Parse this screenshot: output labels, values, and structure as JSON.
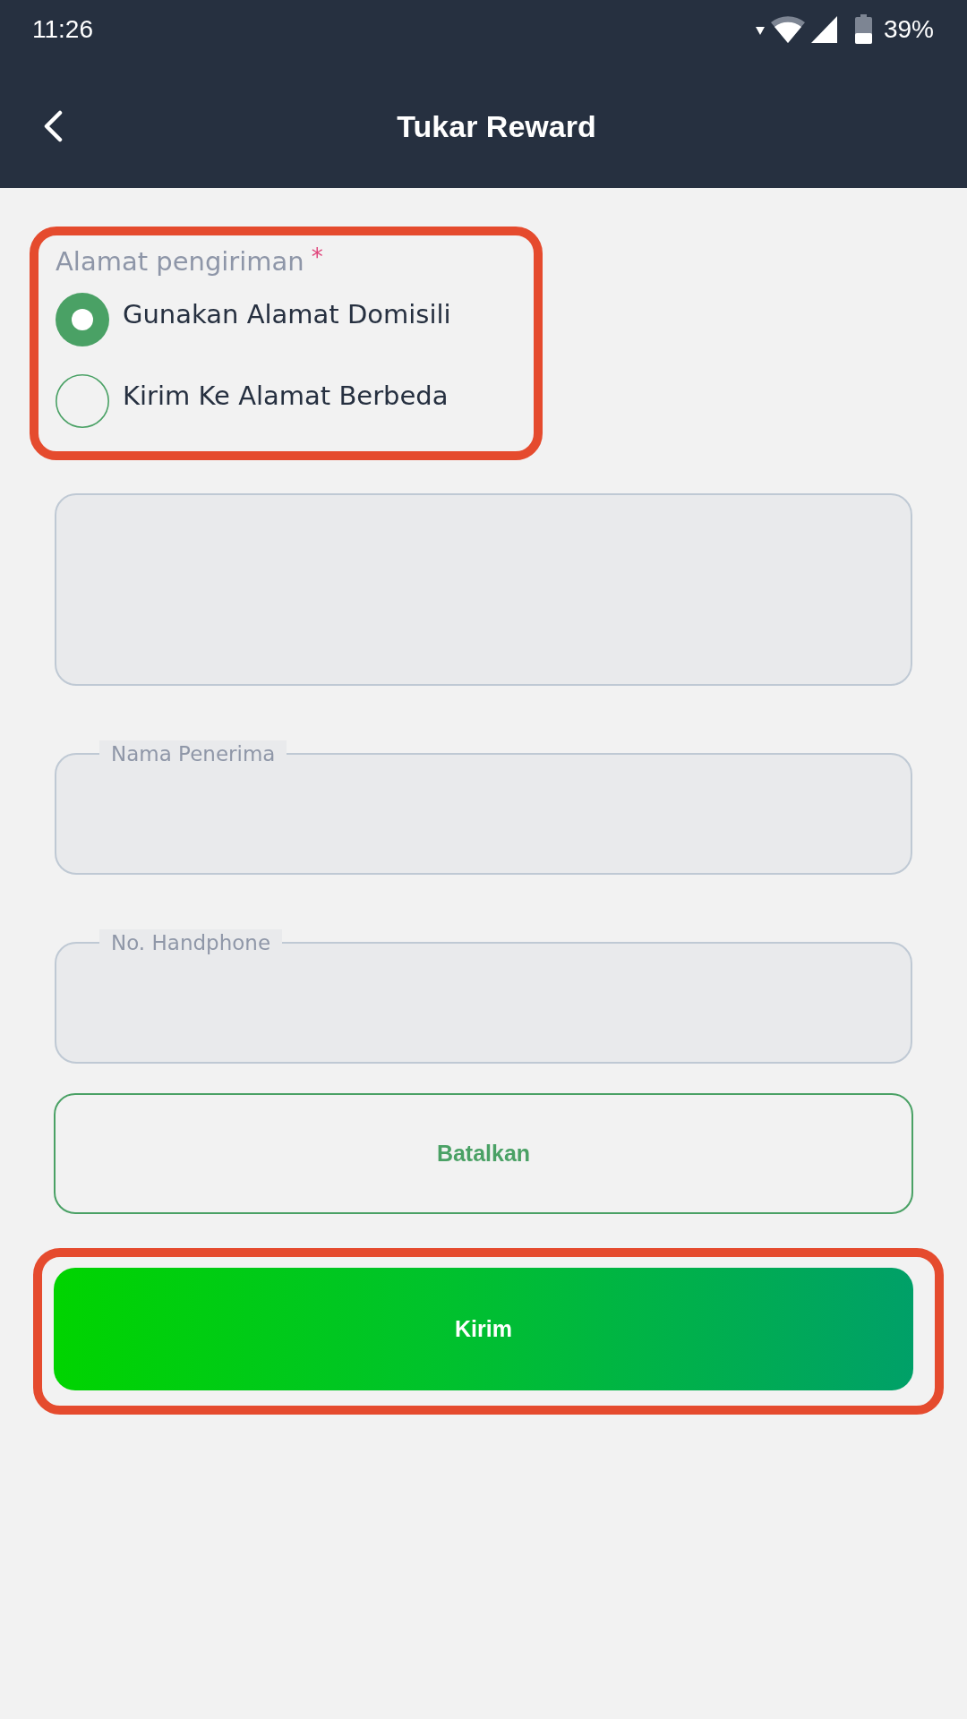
{
  "status_bar": {
    "time": "11:26",
    "battery": "39%"
  },
  "app_bar": {
    "title": "Tukar Reward"
  },
  "shipping_address": {
    "label": "Alamat pengiriman",
    "required_mark": "*",
    "highlighted": true,
    "options": [
      {
        "label": "Gunakan Alamat Domisili",
        "selected": true
      },
      {
        "label": "Kirim Ke Alamat Berbeda",
        "selected": false
      }
    ]
  },
  "fields": [
    {
      "kind": "textarea"
    },
    {
      "kind": "input",
      "label": "Nama Penerima"
    },
    {
      "kind": "input",
      "label": "No. Handphone"
    }
  ],
  "buttons": [
    {
      "label": "Batalkan",
      "kind": "outline",
      "highlighted": false
    },
    {
      "label": "Kirim",
      "kind": "primary",
      "highlighted": true
    }
  ]
}
